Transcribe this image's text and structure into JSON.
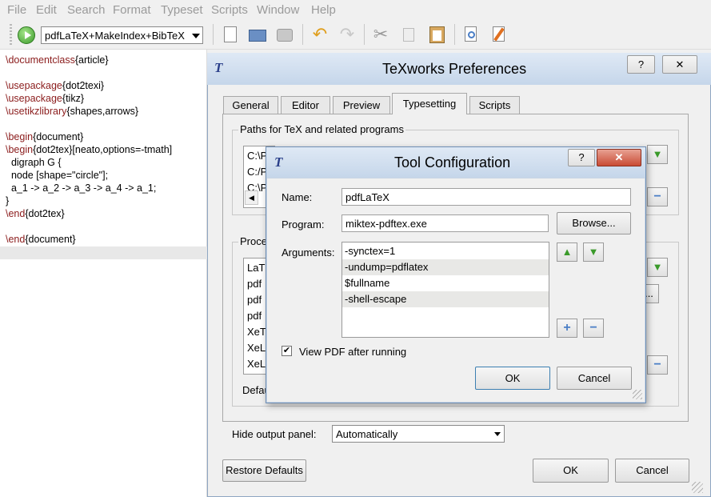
{
  "menubar": {
    "items": [
      "File",
      "Edit",
      "Search",
      "Format",
      "Typeset",
      "Scripts",
      "Window",
      "Help"
    ]
  },
  "toolbar": {
    "typeset_mode": "pdfLaTeX+MakeIndex+BibTeX",
    "icons": [
      "typeset-icon",
      "new-icon",
      "open-icon",
      "save-icon",
      "undo-icon",
      "redo-icon",
      "cut-icon",
      "copy-icon",
      "paste-icon",
      "find-icon",
      "replace-icon"
    ]
  },
  "editor": {
    "lines": [
      [
        {
          "kw": "\\documentclass"
        },
        {
          "t": "{article}"
        }
      ],
      [],
      [
        {
          "kw": "\\usepackage"
        },
        {
          "t": "{dot2texi}"
        }
      ],
      [
        {
          "kw": "\\usepackage"
        },
        {
          "t": "{tikz}"
        }
      ],
      [
        {
          "kw": "\\usetikzlibrary"
        },
        {
          "t": "{shapes,arrows}"
        }
      ],
      [],
      [
        {
          "kw": "\\begin"
        },
        {
          "t": "{document}"
        }
      ],
      [
        {
          "kw": "\\begin"
        },
        {
          "t": "{dot2tex}[neato,options=-tmath]"
        }
      ],
      [
        {
          "t": "  digraph G {"
        }
      ],
      [
        {
          "t": "  node [shape=\"circle\"];"
        }
      ],
      [
        {
          "t": "  a_1 -> a_2 -> a_3 -> a_4 -> a_1;"
        }
      ],
      [
        {
          "t": "}"
        }
      ],
      [
        {
          "kw": "\\end"
        },
        {
          "t": "{dot2tex}"
        }
      ],
      [],
      [
        {
          "kw": "\\end"
        },
        {
          "t": "{document}"
        }
      ]
    ]
  },
  "prefs": {
    "title": "TeXworks Preferences",
    "help_label": "?",
    "close_label": "✕",
    "tabs": [
      "General",
      "Editor",
      "Preview",
      "Typesetting",
      "Scripts"
    ],
    "paths_group": "Paths for TeX and related programs",
    "paths_items": [
      "C:\\P",
      "C:/P",
      "C:\\P"
    ],
    "proc_group": "Proce",
    "proc_items": [
      "LaT",
      "pdf",
      "pdf",
      "pdf",
      "XeT",
      "XeL",
      "XeL"
    ],
    "defau_label": "Defau",
    "ellipsis": "...",
    "hide_output_label": "Hide output panel:",
    "hide_output_value": "Automatically",
    "restore_label": "Restore Defaults",
    "ok_label": "OK",
    "cancel_label": "Cancel"
  },
  "tool_config": {
    "title": "Tool Configuration",
    "help_label": "?",
    "close_label": "✕",
    "name_label": "Name:",
    "name_value": "pdfLaTeX",
    "program_label": "Program:",
    "program_value": "miktex-pdftex.exe",
    "browse_label": "Browse...",
    "arguments_label": "Arguments:",
    "arguments": [
      "-synctex=1",
      "-undump=pdflatex",
      "$fullname",
      "-shell-escape"
    ],
    "view_pdf_label": "View PDF after running",
    "view_pdf_checked": true,
    "check_mark": "✔",
    "ok_label": "OK",
    "cancel_label": "Cancel"
  }
}
